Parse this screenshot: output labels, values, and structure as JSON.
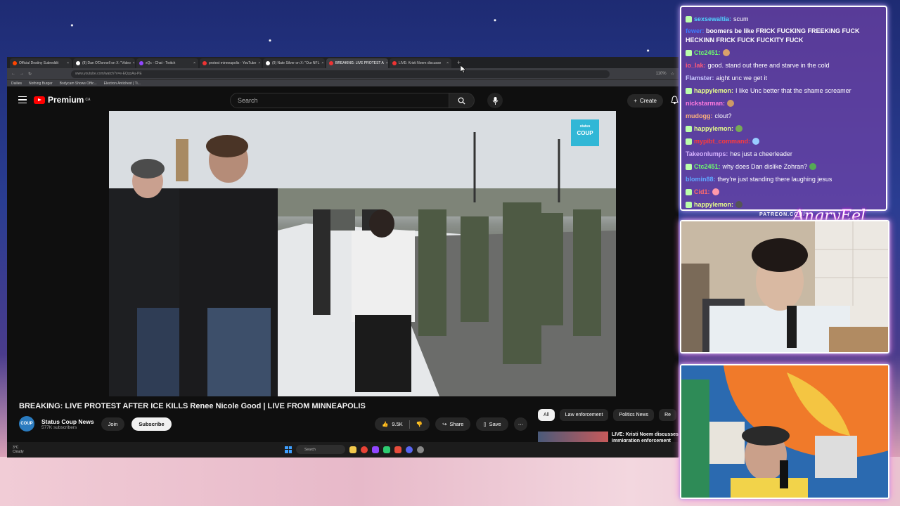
{
  "browser": {
    "tabs": [
      {
        "label": "Official Destiny Subreddit"
      },
      {
        "label": "(8) Dan O'Donnell on X: \"Video"
      },
      {
        "label": "xQc - Chat - Twitch"
      },
      {
        "label": "protest minneapolis - YouTube"
      },
      {
        "label": "(9) Nate Silver on X: \"Our NFL"
      },
      {
        "label": "BREAKING: LIVE PROTEST A"
      },
      {
        "label": "LIVE: Kristi Noem discusse"
      }
    ],
    "active_tab_index": 5,
    "url": "www.youtube.com/watch?v=e-EQzpAu-PE",
    "zoom": "110%",
    "bookmarks": [
      "Dailies",
      "Nothing Burger",
      "Bodycam Shows Offic...",
      "Electron Antichest | Ti..."
    ]
  },
  "youtube": {
    "logo_text": "Premium",
    "region": "CA",
    "search_placeholder": "Search",
    "create_label": "Create",
    "video": {
      "overlay_logo": "COUP",
      "overlay_logo_small": "status",
      "title": "BREAKING: LIVE PROTEST AFTER ICE KILLS Renee Nicole Good | LIVE FROM MINNEAPOLIS"
    },
    "channel": {
      "avatar_text": "COUP",
      "name": "Status Coup News",
      "subscribers": "577K subscribers",
      "join_label": "Join",
      "subscribe_label": "Subscribe"
    },
    "actions": {
      "likes": "9.5K",
      "share": "Share",
      "save": "Save"
    },
    "chips": [
      "All",
      "Law enforcement",
      "Politics News",
      "Re"
    ],
    "recommended": {
      "title": "LIVE: Kristi Noem discusses immigration enforcement"
    }
  },
  "taskbar": {
    "temperature": "3°C",
    "weather": "Cloudy",
    "search_placeholder": "Search"
  },
  "chat": {
    "messages": [
      {
        "user": "sexsewaltia:",
        "text": "scum",
        "color": "#4fd3ff"
      },
      {
        "user": "fewer:",
        "text": "boomers be like FRICK FUCKING FREEKING FUCK HECKINN FRICK FUCK FUCKITY FUCK",
        "color": "#3f7cff"
      },
      {
        "user": "Ctc2451:",
        "text": "",
        "color": "#6dff6d"
      },
      {
        "user": "io_lak:",
        "text": "good. stand out there and starve in the cold",
        "color": "#ff5a7a"
      },
      {
        "user": "Flamster:",
        "text": "aight unc we get it",
        "color": "#c9c9ff"
      },
      {
        "user": "happylemon:",
        "text": "I like Unc better that the shame screamer",
        "color": "#e7ff8a"
      },
      {
        "user": "nickstarman:",
        "text": "",
        "color": "#ff7adf"
      },
      {
        "user": "mudogg:",
        "text": "clout?",
        "color": "#ffb27a"
      },
      {
        "user": "happylemon:",
        "text": "",
        "color": "#e7ff8a"
      },
      {
        "user": "mypibt_command:",
        "text": "",
        "color": "#ff3a3a"
      },
      {
        "user": "Takeonlumps:",
        "text": "hes just a cheerleader",
        "color": "#d6b3ff"
      },
      {
        "user": "Ctc2451:",
        "text": "why does Dan dislike Zohran?",
        "color": "#6dff6d"
      },
      {
        "user": "blomin88:",
        "text": "they're just standing there laughing jesus",
        "color": "#5fa8ff"
      },
      {
        "user": "Cid1:",
        "text": "",
        "color": "#ff6a6a"
      },
      {
        "user": "happylemon:",
        "text": "",
        "color": "#e7ff8a"
      }
    ]
  },
  "overlay": {
    "patreon": "PATREON.COM/",
    "signature": "AngryEel"
  }
}
